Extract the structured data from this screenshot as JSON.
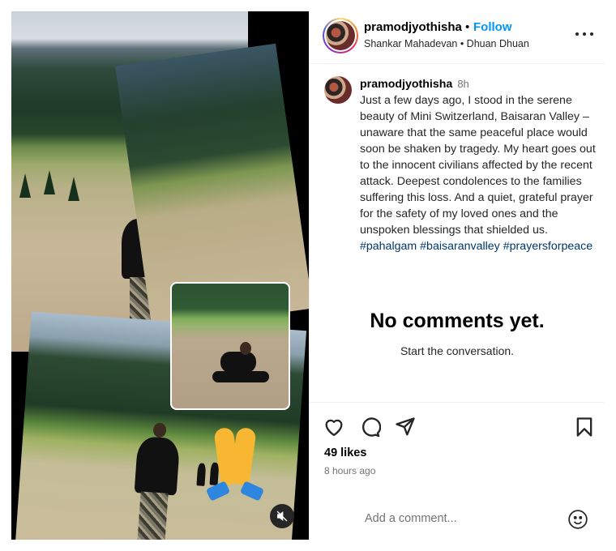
{
  "post": {
    "username": "pramodjyothisha",
    "follow_label": "Follow",
    "separator": "•",
    "audio": "Shankar Mahadevan • Dhuan Dhuan",
    "more_icon": "more-horizontal-icon"
  },
  "caption": {
    "username": "pramodjyothisha",
    "time": "8h",
    "text": "Just a few days ago, I stood in the serene beauty of Mini Switzerland, Baisaran Valley – unaware that the same peaceful place would soon be shaken by tragedy. My heart goes out to the innocent civilians affected by the recent attack. Deepest condolences to the families suffering this loss. And a quiet, grateful prayer for the safety of my loved ones and the unspoken blessings that shielded us.",
    "hashtags": [
      "#pahalgam",
      "#baisaranvalley",
      "#prayersforpeace"
    ]
  },
  "comments": {
    "empty_title": "No comments yet.",
    "empty_subtitle": "Start the conversation."
  },
  "actions": {
    "like_icon": "heart-icon",
    "comment_icon": "comment-icon",
    "share_icon": "send-icon",
    "save_icon": "bookmark-icon",
    "likes": "49 likes",
    "time_ago": "8 hours ago"
  },
  "add_comment": {
    "placeholder": "Add a comment...",
    "emoji_icon": "emoji-icon"
  },
  "media": {
    "mute_icon": "muted-speaker-icon",
    "sticker": "folded-hands-emoji"
  },
  "colors": {
    "link": "#0095f6",
    "hashtag": "#00376b",
    "muted": "#737373",
    "border": "#efefef"
  }
}
